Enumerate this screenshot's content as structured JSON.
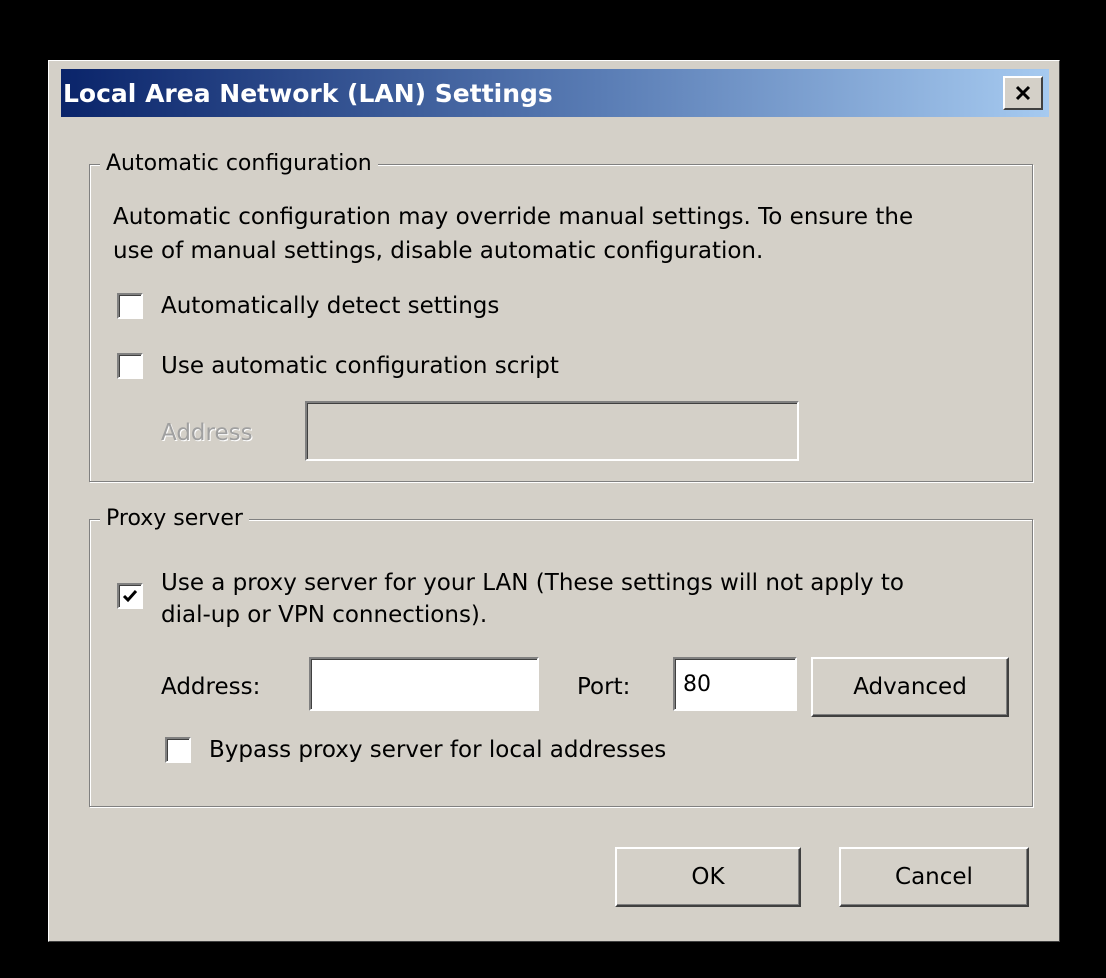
{
  "window": {
    "title": "Local Area Network (LAN) Settings",
    "close_icon": "close-icon"
  },
  "auto_config": {
    "legend": "Automatic configuration",
    "description_line1": "Automatic configuration may override manual settings.  To ensure the",
    "description_line2": "use of manual settings, disable automatic configuration.",
    "detect_settings": {
      "label": "Automatically detect settings",
      "checked": false
    },
    "use_script": {
      "label": "Use automatic configuration script",
      "checked": false
    },
    "address_label": "Address",
    "address_value": ""
  },
  "proxy": {
    "legend": "Proxy server",
    "use_proxy": {
      "label_line1": "Use a proxy server for your LAN (These settings will not apply to",
      "label_line2": "dial-up or VPN connections).",
      "checked": true
    },
    "address_label": "Address:",
    "address_value": "",
    "port_label": "Port:",
    "port_value": "80",
    "advanced_label": "Advanced",
    "bypass": {
      "label": "Bypass proxy server for local addresses",
      "checked": false
    }
  },
  "buttons": {
    "ok": "OK",
    "cancel": "Cancel"
  }
}
